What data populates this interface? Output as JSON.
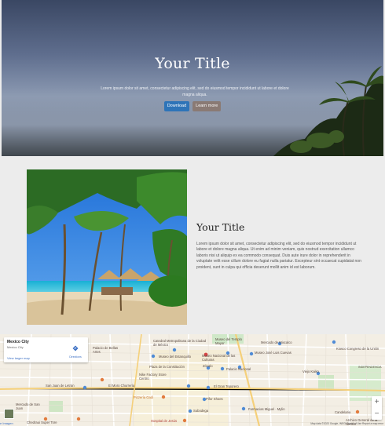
{
  "hero": {
    "title": "Your Title",
    "text": "Lorem ipsum dolor sit amet, consectetur adipiscing elit, sed do eiusmod tempor incididunt ut labore et dolore magna aliqua.",
    "primary_button": "Download",
    "secondary_button": "Learn more"
  },
  "feature": {
    "title": "Your Title",
    "text": "Lorem ipsum dolor sit amet, consectetur adipiscing elit, sed do eiusmod tempor incididunt ut labore et dolore magna aliqua. Ut enim ad minim veniam, quis nostrud exercitation ullamco laboris nisi ut aliquip ex ea commodo consequat. Duis aute irure dolor in reprehenderit in voluptate velit esse cillum dolore eu fugiat nulla pariatur. Excepteur sint occaecat cupidatat non proident, sunt in culpa qui officia deserunt mollit anim id est laborum."
  },
  "map": {
    "card": {
      "place": "Mexico City",
      "subtitle": "Mexico City",
      "directions": "Directions",
      "larger_map": "View larger map"
    },
    "labels": [
      "Catedral Metropolitana de la Ciudad de México",
      "Museo del Templo Mayor",
      "Mercado de Mixcalco",
      "Kiosco Congreso de la Unión",
      "Museo José Luis Cuevas",
      "Palacio de Bellas Artes",
      "Museo del Estanquillo",
      "Museo Nacional de las Culturas",
      "Plaza de la Constitución",
      "Zócalo",
      "Palacio Nacional",
      "Viejo Kaiko",
      "INDEPENDENCIA",
      "Nike Factory Store Centro",
      "San Juan de Letrán",
      "El Moro Churrería",
      "El Gran Teporero",
      "Pizzería Gadi",
      "Pifor Shoes",
      "Mercado de San Juan",
      "Subodega",
      "Farmacias Miguel · Mylin",
      "Candelaria",
      "Chedraui Super Tore",
      "Hospital de Jesús",
      "Archivo General de la Nación"
    ],
    "zoom_in": "+",
    "zoom_out": "−",
    "attribution": "Map data ©2023 Google, INEGI   Terms of Use   Report a map error",
    "smaller_label": "e Imagen"
  },
  "colors": {
    "primary_button": "#2e74b8",
    "secondary_button": "#8a7a74"
  }
}
